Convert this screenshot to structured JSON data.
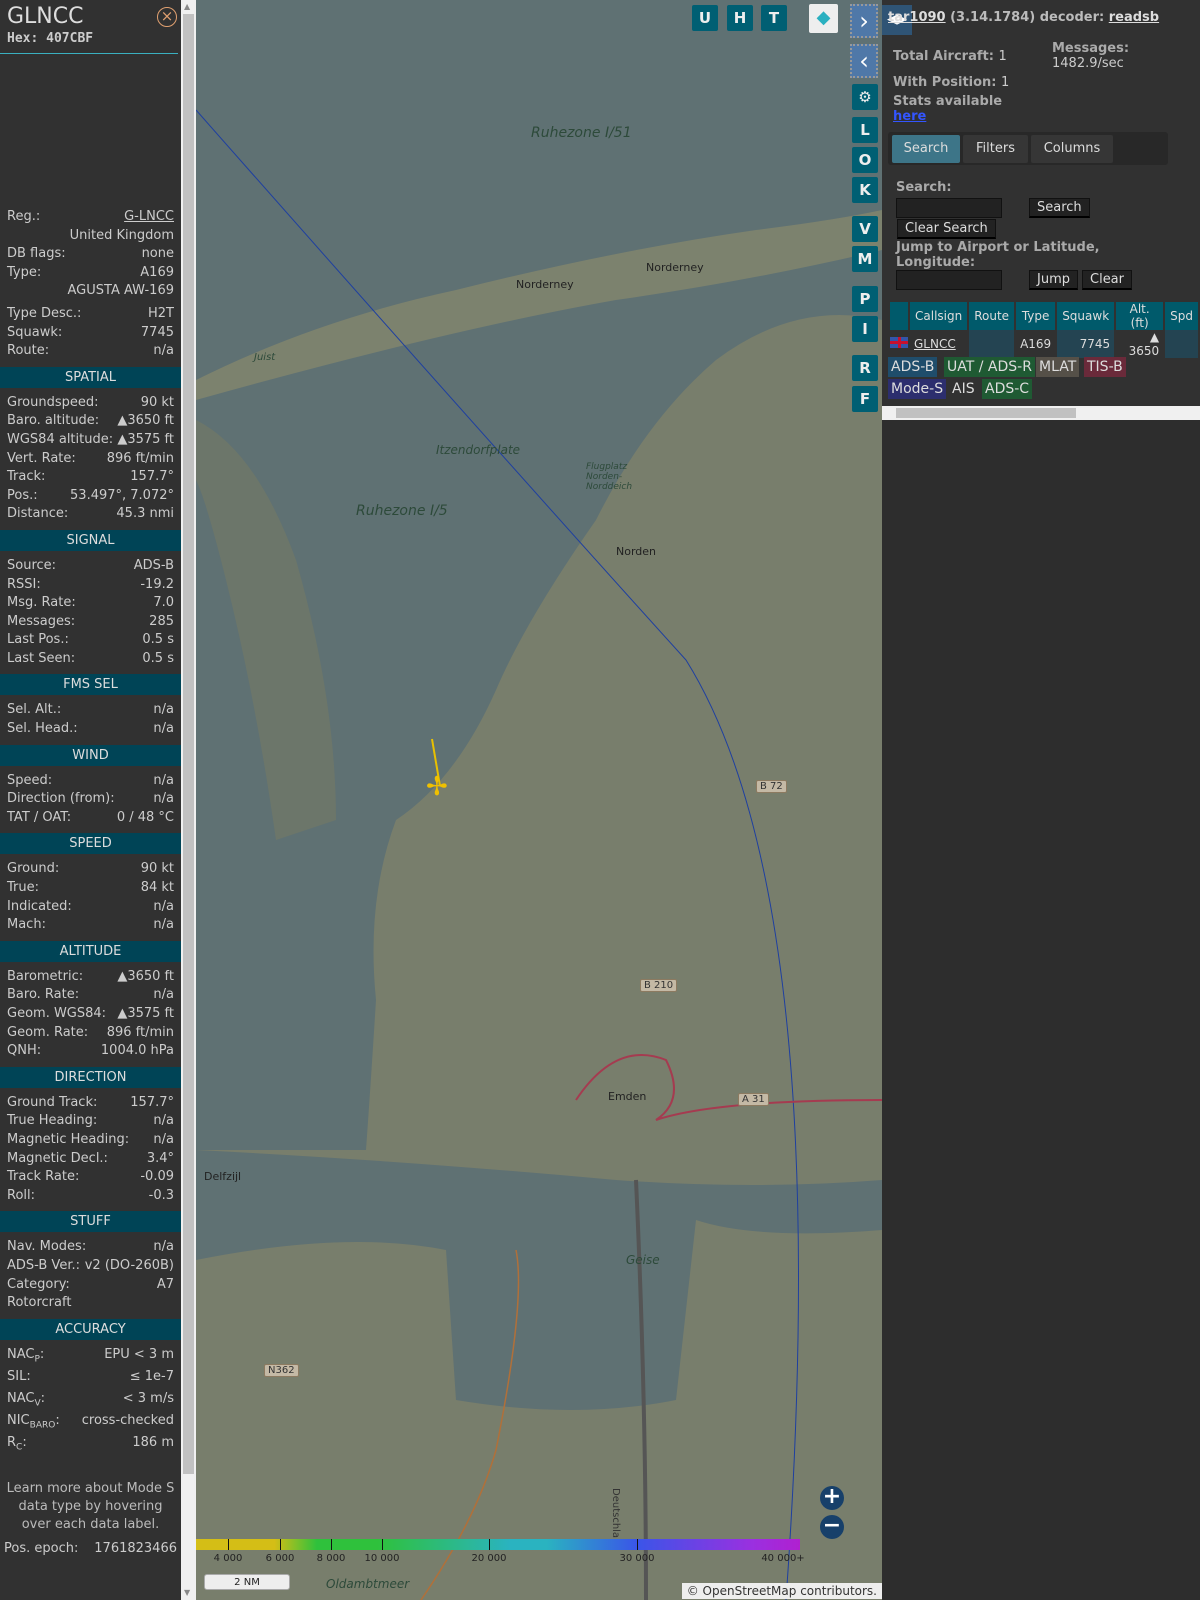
{
  "aircraft": {
    "title": "GLNCC",
    "hex": "Hex: 407CBF",
    "close_icon": "circle-x-icon"
  },
  "info": {
    "top": [
      {
        "label": "Reg.:",
        "value": "G-LNCC",
        "link": true
      },
      {
        "label": "",
        "value": "United Kingdom"
      },
      {
        "label": "DB flags:",
        "value": "none"
      },
      {
        "label": "Type:",
        "value": "A169"
      },
      {
        "label": "",
        "value": "AGUSTA AW-169"
      },
      {
        "label": "Type Desc.:",
        "value": "H2T"
      },
      {
        "label": "Squawk:",
        "value": "7745"
      },
      {
        "label": "Route:",
        "value": "n/a"
      }
    ],
    "sections": [
      {
        "title": "SPATIAL",
        "rows": [
          {
            "label": "Groundspeed:",
            "value": "90 kt"
          },
          {
            "label": "Baro. altitude:",
            "value": "▲3650 ft"
          },
          {
            "label": "WGS84 altitude:",
            "value": "▲3575 ft"
          },
          {
            "label": "Vert. Rate:",
            "value": "896 ft/min"
          },
          {
            "label": "Track:",
            "value": "157.7°"
          },
          {
            "label": "Pos.:",
            "value": "53.497°, 7.072°"
          },
          {
            "label": "Distance:",
            "value": "45.3 nmi"
          }
        ]
      },
      {
        "title": "SIGNAL",
        "rows": [
          {
            "label": "Source:",
            "value": "ADS-B"
          },
          {
            "label": "RSSI:",
            "value": "-19.2"
          },
          {
            "label": "Msg. Rate:",
            "value": "7.0"
          },
          {
            "label": "Messages:",
            "value": "285"
          },
          {
            "label": "Last Pos.:",
            "value": "0.5 s"
          },
          {
            "label": "Last Seen:",
            "value": "0.5 s"
          }
        ]
      },
      {
        "title": "FMS SEL",
        "rows": [
          {
            "label": "Sel. Alt.:",
            "value": "n/a"
          },
          {
            "label": "Sel. Head.:",
            "value": "n/a"
          }
        ]
      },
      {
        "title": "WIND",
        "rows": [
          {
            "label": "Speed:",
            "value": "n/a"
          },
          {
            "label": "Direction (from):",
            "value": "n/a"
          },
          {
            "label": "TAT / OAT:",
            "value": "0 / 48 °C"
          }
        ]
      },
      {
        "title": "SPEED",
        "rows": [
          {
            "label": "Ground:",
            "value": "90 kt"
          },
          {
            "label": "True:",
            "value": "84 kt"
          },
          {
            "label": "Indicated:",
            "value": "n/a"
          },
          {
            "label": "Mach:",
            "value": "n/a"
          }
        ]
      },
      {
        "title": "ALTITUDE",
        "rows": [
          {
            "label": "Barometric:",
            "value": "▲3650 ft"
          },
          {
            "label": "Baro. Rate:",
            "value": "n/a"
          },
          {
            "label": "Geom. WGS84:",
            "value": "▲3575 ft"
          },
          {
            "label": "Geom. Rate:",
            "value": "896 ft/min"
          },
          {
            "label": "QNH:",
            "value": "1004.0 hPa"
          }
        ]
      },
      {
        "title": "DIRECTION",
        "rows": [
          {
            "label": "Ground Track:",
            "value": "157.7°"
          },
          {
            "label": "True Heading:",
            "value": "n/a"
          },
          {
            "label": "Magnetic Heading:",
            "value": "n/a"
          },
          {
            "label": "Magnetic Decl.:",
            "value": "3.4°"
          },
          {
            "label": "Track Rate:",
            "value": "-0.09"
          },
          {
            "label": "Roll:",
            "value": "-0.3"
          }
        ]
      },
      {
        "title": "STUFF",
        "rows": [
          {
            "label": "Nav. Modes:",
            "value": "n/a"
          },
          {
            "label": "ADS-B Ver.:",
            "value": "v2 (DO-260B)"
          },
          {
            "label": "Category:",
            "value": "A7"
          },
          {
            "label": "Rotorcraft",
            "value": ""
          }
        ]
      }
    ],
    "accuracy": {
      "title": "ACCURACY",
      "rows": [
        {
          "label": "NAC",
          "sub": "P",
          "value": "EPU < 3 m"
        },
        {
          "label": "SIL",
          "sub": "",
          "value": "≤ 1e-7"
        },
        {
          "label": "NAC",
          "sub": "V",
          "value": "< 3 m/s"
        },
        {
          "label": "NIC",
          "sub": "BARO",
          "value": "cross-checked"
        },
        {
          "label": "R",
          "sub": "C",
          "value": "186 m"
        }
      ]
    },
    "learn": "Learn more about Mode S data type by hovering over each data label.",
    "epoch_label": "Pos. epoch:",
    "epoch_value": "1761823466"
  },
  "map": {
    "buttons_top": [
      "U",
      "H",
      "T"
    ],
    "buttons_side": [
      "L",
      "O",
      "K",
      "V",
      "M",
      "P",
      "I",
      "R",
      "F"
    ],
    "labels": {
      "ruhezone_i51": "Ruhezone I/51",
      "ruhezone_i5": "Ruhezone I/5",
      "norderney": "Norderney",
      "norderney2": "Norderney",
      "norden": "Norden",
      "emden": "Emden",
      "delfzijl": "Delfzijl",
      "itzendorf": "Itzendorfplate",
      "flugplatz": "Flugplatz Norden-Norddeich",
      "juist": "Juist",
      "oldambtmeer": "Oldambtmeer",
      "geise": "Geise",
      "deutschland": "Deutschland"
    },
    "roads": [
      "B 72",
      "B 210",
      "A 31",
      "N362"
    ],
    "altitude_scale": [
      "4 000",
      "6 000",
      "8 000",
      "10 000",
      "20 000",
      "30 000",
      "40 000+"
    ],
    "scale_label": "2 NM",
    "attribution_prefix": "© ",
    "attribution_link": "OpenStreetMap",
    "attribution_suffix": " contributors."
  },
  "sidebar": {
    "title_link": "tar1090",
    "version": " (3.14.1784) decoder: ",
    "decoder": "readsb",
    "total_label": "Total Aircraft:",
    "total": "1",
    "messages_label": "Messages:",
    "messages": "1482.9/sec",
    "withpos_label": "With Position:",
    "withpos": "1",
    "stats": "Stats available",
    "stats_link": "here",
    "tabs": [
      "Search",
      "Filters",
      "Columns"
    ],
    "search_label": "Search:",
    "search_btn": "Search",
    "clear_search": "Clear Search",
    "jump_label": "Jump to Airport or Latitude, Longitude:",
    "jump_btn": "Jump",
    "clear_btn": "Clear",
    "columns": [
      "",
      "Callsign",
      "Route",
      "Type",
      "Squawk",
      "Alt. (ft)",
      "Spd"
    ],
    "row": {
      "flag": "uk-flag-icon",
      "callsign": "GLNCC",
      "route": "",
      "type": "A169",
      "squawk": "7745",
      "alt": "▲ 3650",
      "spd": ""
    },
    "legend": [
      {
        "label": "ADS-B",
        "color": "#1f4d6b"
      },
      {
        "label": "UAT / ADS-R",
        "color": "#1f5a33"
      },
      {
        "label": "MLAT",
        "color": "#555048"
      },
      {
        "label": "TIS-B",
        "color": "#6a2a3a"
      },
      {
        "label": "Mode-S",
        "color": "#2c2e6e"
      },
      {
        "label": "AIS",
        "color": ""
      },
      {
        "label": "ADS-C",
        "color": "#1f5a33"
      }
    ]
  }
}
